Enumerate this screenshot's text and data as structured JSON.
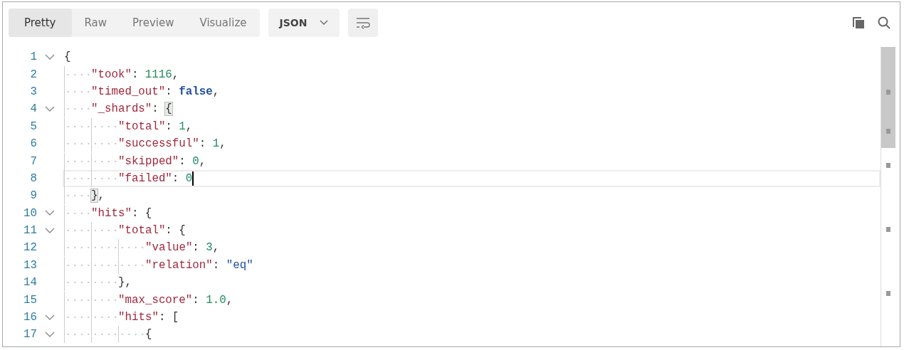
{
  "tabs": [
    {
      "label": "Pretty",
      "selected": true
    },
    {
      "label": "Raw",
      "selected": false
    },
    {
      "label": "Preview",
      "selected": false
    },
    {
      "label": "Visualize",
      "selected": false
    }
  ],
  "format_dropdown": {
    "value": "JSON"
  },
  "lines": [
    {
      "number": "1",
      "expanded": true,
      "active": false,
      "tokens": [
        {
          "kind": "punct",
          "text": "{"
        }
      ],
      "children": [
        {
          "number": "2",
          "active": false,
          "tokens": [
            {
              "kind": "key",
              "text": "\"took\""
            },
            {
              "kind": "punct",
              "text": ": "
            },
            {
              "kind": "num",
              "text": "1116"
            },
            {
              "kind": "punct",
              "text": ","
            }
          ]
        },
        {
          "number": "3",
          "active": false,
          "tokens": [
            {
              "kind": "key",
              "text": "\"timed_out\""
            },
            {
              "kind": "punct",
              "text": ": "
            },
            {
              "kind": "bool",
              "text": "false"
            },
            {
              "kind": "punct",
              "text": ","
            }
          ]
        },
        {
          "number": "4",
          "expanded": true,
          "active": false,
          "tokens": [
            {
              "kind": "key",
              "text": "\"_shards\""
            },
            {
              "kind": "punct",
              "text": ": "
            },
            {
              "kind": "match",
              "text": "{"
            }
          ],
          "children": [
            {
              "number": "5",
              "active": false,
              "tokens": [
                {
                  "kind": "key",
                  "text": "\"total\""
                },
                {
                  "kind": "punct",
                  "text": ": "
                },
                {
                  "kind": "num",
                  "text": "1"
                },
                {
                  "kind": "punct",
                  "text": ","
                }
              ]
            },
            {
              "number": "6",
              "active": false,
              "tokens": [
                {
                  "kind": "key",
                  "text": "\"successful\""
                },
                {
                  "kind": "punct",
                  "text": ": "
                },
                {
                  "kind": "num",
                  "text": "1"
                },
                {
                  "kind": "punct",
                  "text": ","
                }
              ]
            },
            {
              "number": "7",
              "active": false,
              "tokens": [
                {
                  "kind": "key",
                  "text": "\"skipped\""
                },
                {
                  "kind": "punct",
                  "text": ": "
                },
                {
                  "kind": "num",
                  "text": "0"
                },
                {
                  "kind": "punct",
                  "text": ","
                }
              ]
            },
            {
              "number": "8",
              "active": true,
              "tokens": [
                {
                  "kind": "key",
                  "text": "\"failed\""
                },
                {
                  "kind": "punct",
                  "text": ": "
                },
                {
                  "kind": "num",
                  "text": "0"
                }
              ]
            }
          ]
        },
        {
          "number": "9",
          "active": false,
          "tokens": [
            {
              "kind": "match",
              "text": "}"
            },
            {
              "kind": "punct",
              "text": ","
            }
          ]
        },
        {
          "number": "10",
          "expanded": true,
          "active": false,
          "tokens": [
            {
              "kind": "key",
              "text": "\"hits\""
            },
            {
              "kind": "punct",
              "text": ": {"
            }
          ],
          "children": [
            {
              "number": "11",
              "expanded": true,
              "active": false,
              "tokens": [
                {
                  "kind": "key",
                  "text": "\"total\""
                },
                {
                  "kind": "punct",
                  "text": ": {"
                }
              ],
              "children": [
                {
                  "number": "12",
                  "active": false,
                  "tokens": [
                    {
                      "kind": "key",
                      "text": "\"value\""
                    },
                    {
                      "kind": "punct",
                      "text": ": "
                    },
                    {
                      "kind": "num",
                      "text": "3"
                    },
                    {
                      "kind": "punct",
                      "text": ","
                    }
                  ]
                },
                {
                  "number": "13",
                  "active": false,
                  "tokens": [
                    {
                      "kind": "key",
                      "text": "\"relation\""
                    },
                    {
                      "kind": "punct",
                      "text": ": "
                    },
                    {
                      "kind": "str",
                      "text": "\"eq\""
                    }
                  ]
                }
              ]
            },
            {
              "number": "14",
              "active": false,
              "tokens": [
                {
                  "kind": "punct",
                  "text": "},"
                }
              ]
            },
            {
              "number": "15",
              "active": false,
              "tokens": [
                {
                  "kind": "key",
                  "text": "\"max_score\""
                },
                {
                  "kind": "punct",
                  "text": ": "
                },
                {
                  "kind": "num",
                  "text": "1.0"
                },
                {
                  "kind": "punct",
                  "text": ","
                }
              ]
            },
            {
              "number": "16",
              "expanded": true,
              "active": false,
              "tokens": [
                {
                  "kind": "key",
                  "text": "\"hits\""
                },
                {
                  "kind": "punct",
                  "text": ": ["
                }
              ],
              "children": [
                {
                  "number": "17",
                  "expanded": true,
                  "active": false,
                  "tokens": [
                    {
                      "kind": "punct",
                      "text": "{"
                    }
                  ]
                }
              ]
            }
          ]
        }
      ]
    }
  ]
}
